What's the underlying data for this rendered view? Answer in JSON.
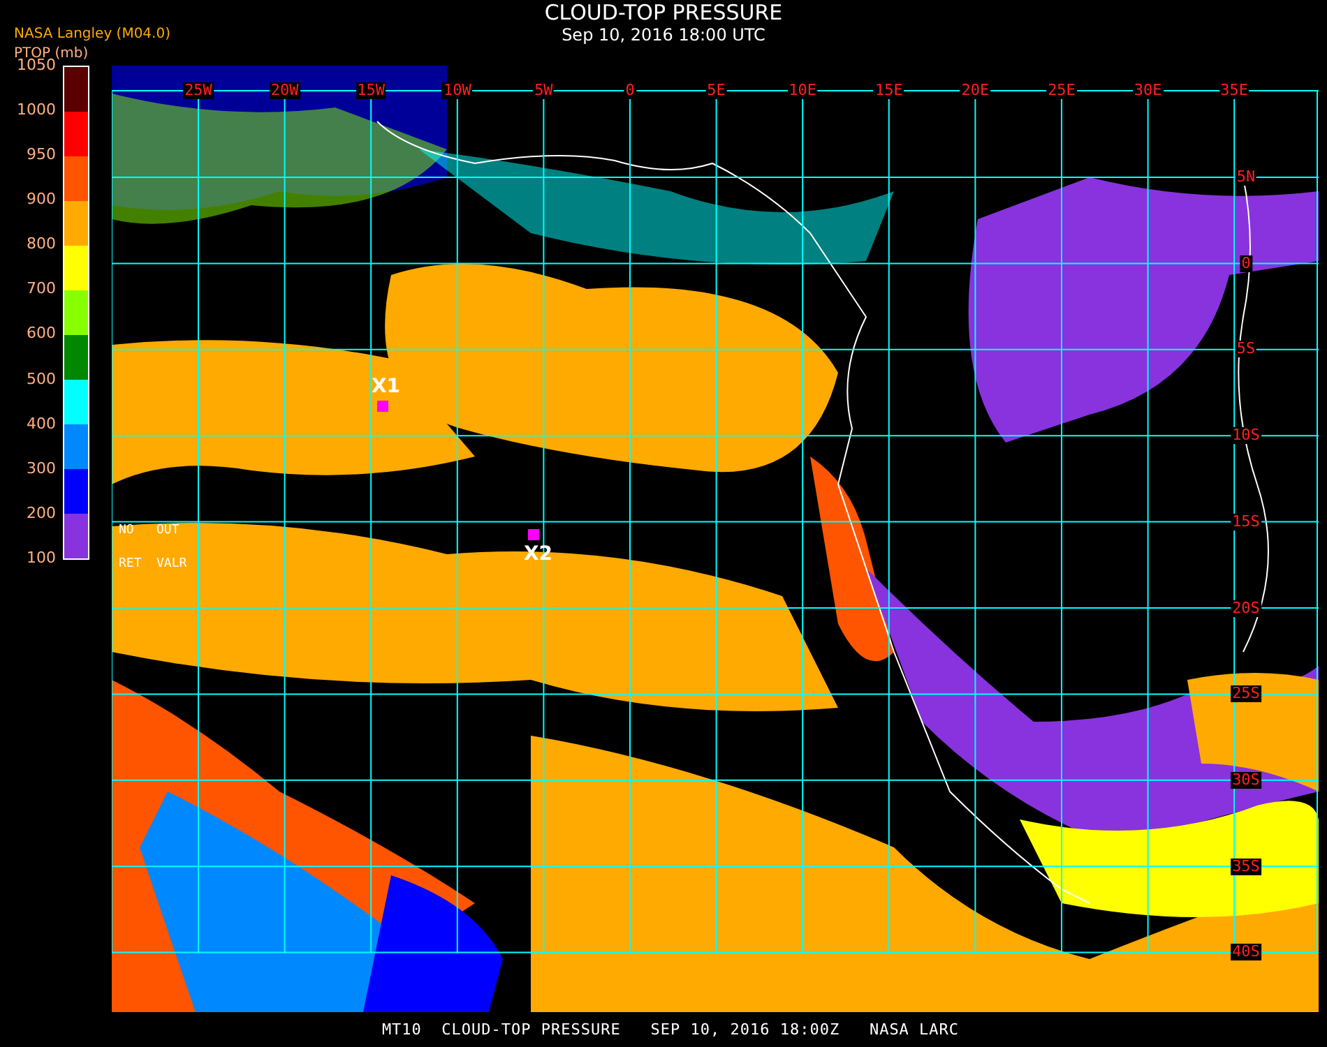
{
  "header": {
    "source": "NASA Langley (M04.0)",
    "title": "CLOUD-TOP PRESSURE",
    "subtitle": "Sep 10, 2016 18:00 UTC"
  },
  "colorbar": {
    "title": "PTOP (mb)",
    "labels": [
      "1050",
      "1000",
      "950",
      "900",
      "800",
      "700",
      "600",
      "500",
      "400",
      "300",
      "200",
      "100"
    ],
    "segments": [
      {
        "color": "#5a0000"
      },
      {
        "color": "#ff0000"
      },
      {
        "color": "#ff5500"
      },
      {
        "color": "#ffaa00"
      },
      {
        "color": "#ffff00"
      },
      {
        "color": "#88ff00"
      },
      {
        "color": "#008800"
      },
      {
        "color": "#00ffff"
      },
      {
        "color": "#0088ff"
      },
      {
        "color": "#0000ff"
      },
      {
        "color": "#8833dd"
      }
    ]
  },
  "map": {
    "lon_labels": [
      "25W",
      "20W",
      "15W",
      "10W",
      "5W",
      "0",
      "5E",
      "10E",
      "15E",
      "20E",
      "25E",
      "30E",
      "35E"
    ],
    "lat_labels": [
      "5N",
      "0",
      "5S",
      "10S",
      "15S",
      "20S",
      "25S",
      "30S",
      "35S",
      "40S"
    ],
    "markers": [
      {
        "label": "X1"
      },
      {
        "label": "X2"
      }
    ],
    "nodata_legend": [
      "NO",
      "OUT",
      "RET",
      "VALR"
    ]
  },
  "footer": "MT10  CLOUD-TOP PRESSURE   SEP 10, 2016 18:00Z   NASA LARC"
}
